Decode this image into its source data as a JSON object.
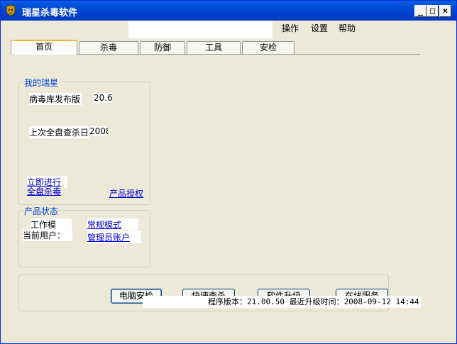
{
  "window": {
    "title": "瑞星杀毒软件"
  },
  "menu": {
    "ops": "操作",
    "settings": "设置",
    "help": "帮助"
  },
  "tabs": [
    {
      "label": "首页",
      "active": true
    },
    {
      "label": "杀毒"
    },
    {
      "label": "防御"
    },
    {
      "label": "工具"
    },
    {
      "label": "安检"
    }
  ],
  "mine": {
    "legend": "我的瑞星",
    "virus_db_label": "病毒库发布版",
    "virus_db_value": "20.6",
    "last_scan_label": "上次全盘查杀日",
    "last_scan_value": "2008",
    "scan_now_link1": "立即进行",
    "scan_now_link2": "全盘杀毒",
    "license_link": "产品授权"
  },
  "status": {
    "legend": "产品状态",
    "mode_label": "工作模",
    "mode_value": "常规模式",
    "user_label": "当前用户：",
    "user_value": "管理员账户"
  },
  "buttons": {
    "check": "电脑安检",
    "quick": "快速查杀",
    "upgrade": "软件升级",
    "service": "在线服务"
  },
  "statusbar": {
    "text": "程序版本：21.00.50  最近升级时间：2008-09-12 14:44"
  },
  "colors": {
    "titlebar": "#0047d2",
    "link": "#0000cc",
    "legend": "#0046d5",
    "tab_accent": "#f8b33d"
  }
}
